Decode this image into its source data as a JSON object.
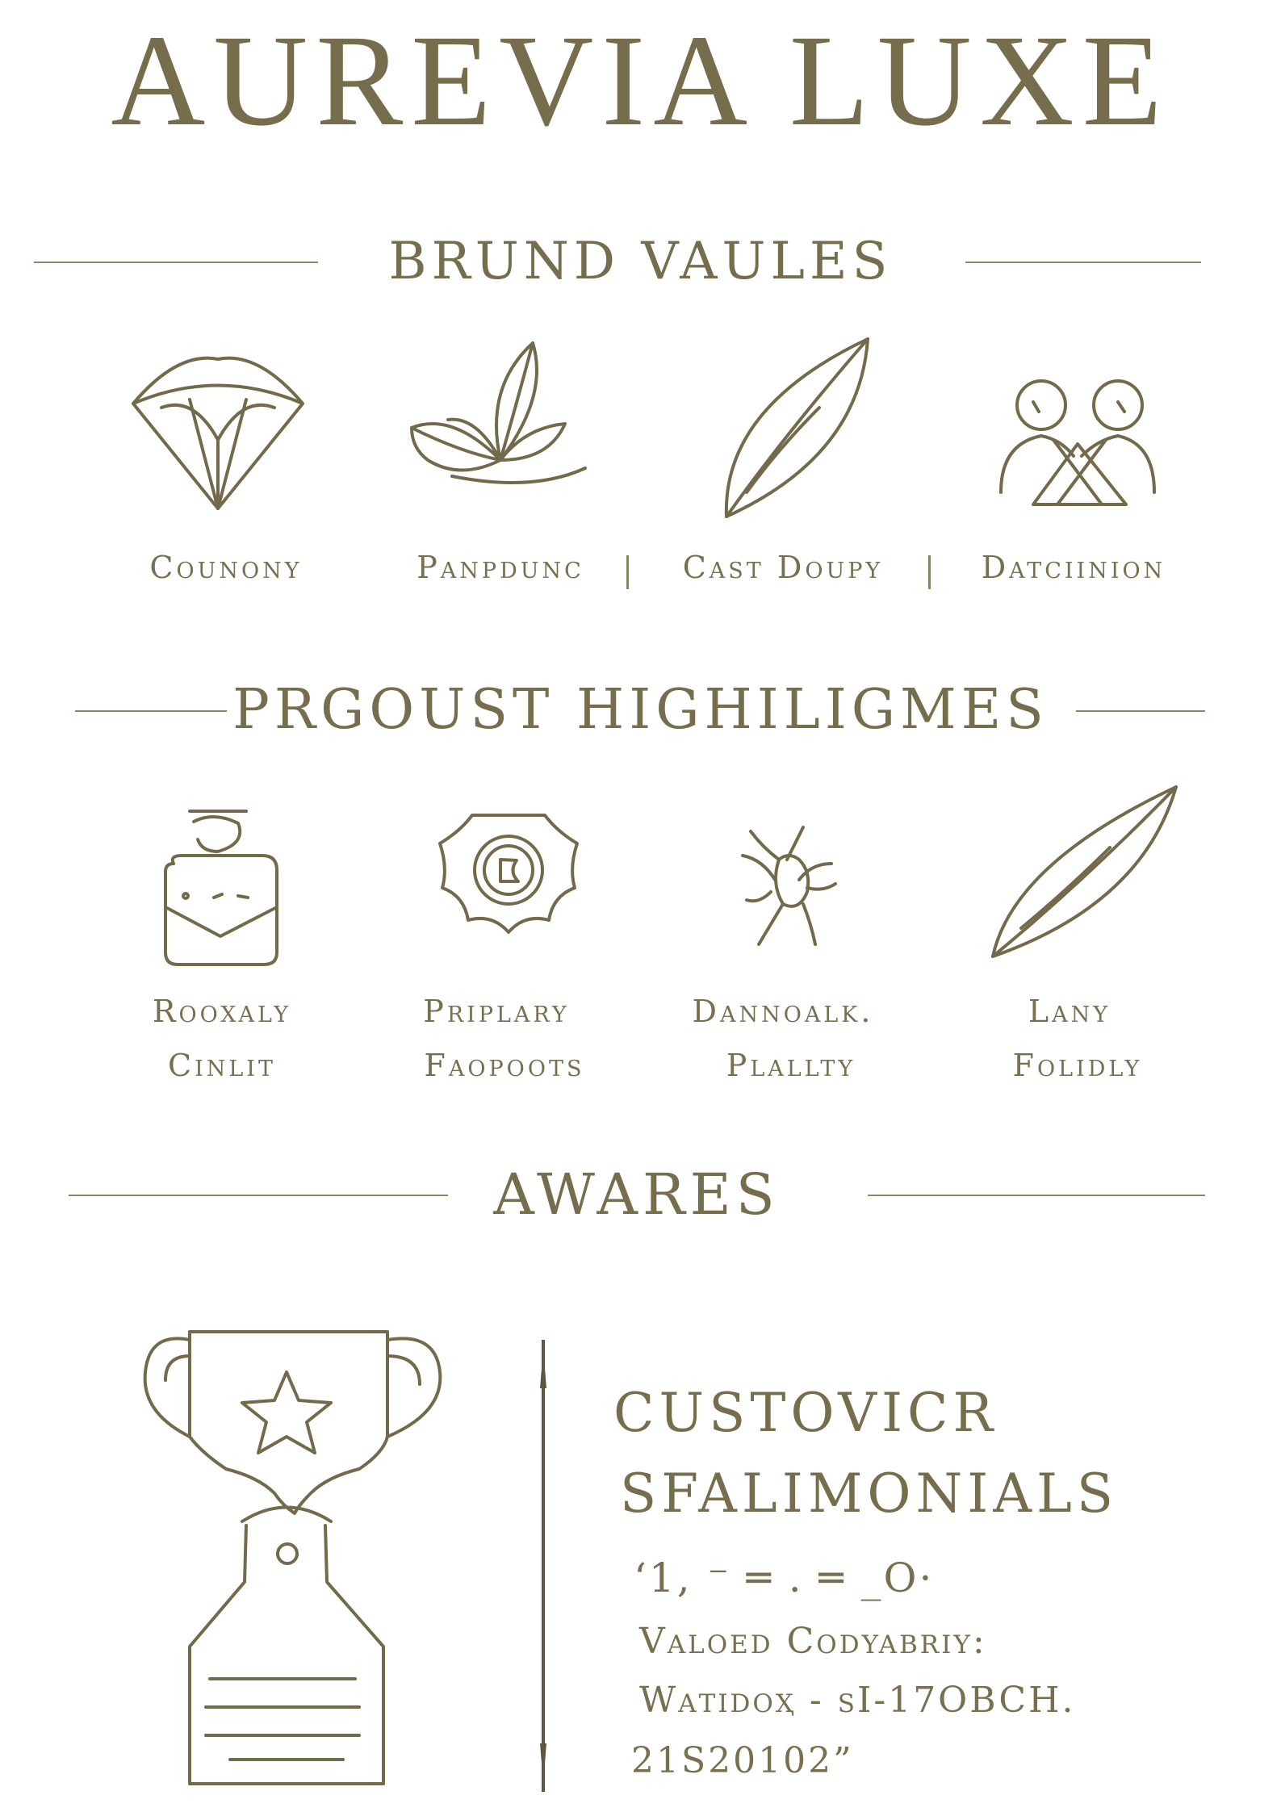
{
  "brand": {
    "title": "AUREVIA LUXE"
  },
  "sections": {
    "brand_values": "BRUND VAULES",
    "product_highlights": "PRGOUST HIGHILIGMES",
    "awards": "AWARES"
  },
  "brand_values": [
    {
      "label": "Counony",
      "icon": "diamond-icon"
    },
    {
      "label": "Panpdunc",
      "icon": "sprout-icon"
    },
    {
      "label": "Cast Doupy",
      "icon": "leaf-icon"
    },
    {
      "label": "Datciinion",
      "icon": "two-people-icon"
    }
  ],
  "separator_glyph": "|",
  "product_highlights": [
    {
      "line1": "Rooxaly",
      "line2": "Cinlit",
      "icon": "bottle-icon"
    },
    {
      "line1": "Priplary",
      "line2": "Faopoots",
      "icon": "seal-badge-icon"
    },
    {
      "line1": "Dannoalk.",
      "line2": "Plallty",
      "icon": "botanical-icon"
    },
    {
      "line1": "Lany",
      "line2": "Folidly",
      "icon": "feather-icon"
    }
  ],
  "awards": {
    "icon": "trophy-icon",
    "testimonials_title_1": "CUSTOVICR",
    "testimonials_title_2": "SFALIMONIALS",
    "squiggle": "‘1, ⁻ ═ . ═ _O·",
    "line1": "Valoed Codyabriy:",
    "line2": "Waтidoҳ - sI-17OBCH.",
    "line3": "21S20102”"
  },
  "colors": {
    "ink": "#756d4c",
    "rule": "#8f8868",
    "background": "#ffffff"
  }
}
